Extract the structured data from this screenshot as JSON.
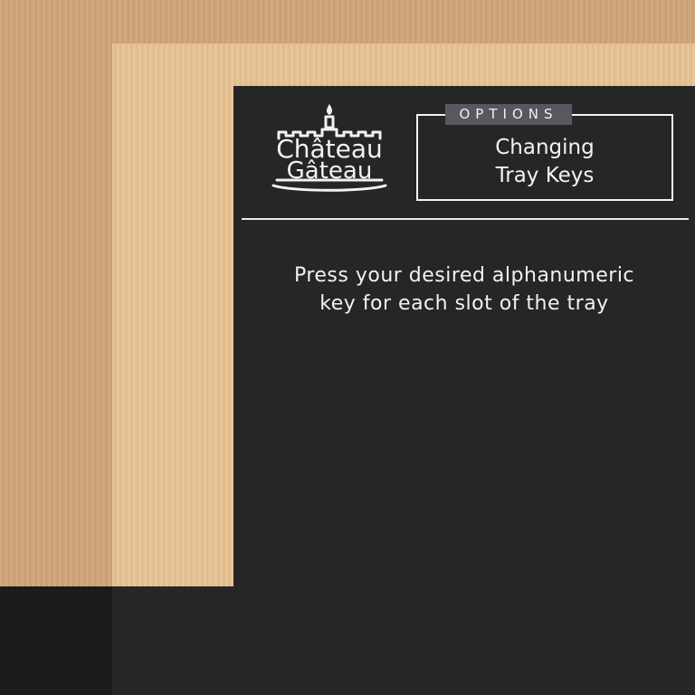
{
  "logo": {
    "line1": "Château",
    "line2": "Gâteau",
    "icon": "candle-castle-cake-icon"
  },
  "options": {
    "tab_label": "OPTIONS",
    "title_line1": "Changing",
    "title_line2": "Tray Keys"
  },
  "instructions": {
    "line1": "Press your desired alphanumeric",
    "line2": "key for each slot of the tray"
  },
  "colors": {
    "panel": "#262626",
    "wood_back": "#cfa478",
    "wood_front": "#e6c293",
    "floor_left": "#1b1b1b",
    "text": "#f2f2f2",
    "tab": "#585860"
  }
}
